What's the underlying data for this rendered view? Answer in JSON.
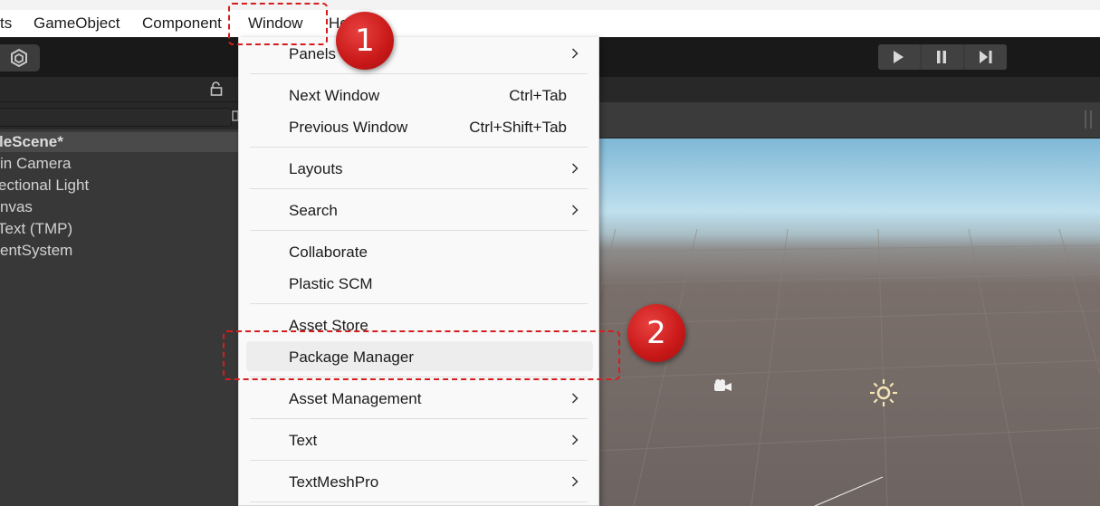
{
  "menubar": {
    "items": [
      "ts",
      "GameObject",
      "Component",
      "Window",
      "Help"
    ]
  },
  "hierarchy": {
    "scene_name": "leScene*",
    "items": [
      "in Camera",
      "ectional Light",
      "nvas",
      "Text (TMP)",
      "entSystem"
    ]
  },
  "toolbar": {
    "icons": [
      "unity-logo-icon",
      "play-icon",
      "pause-icon",
      "step-icon"
    ]
  },
  "window_menu": {
    "items": [
      {
        "label": "Panels",
        "shortcut": "",
        "submenu": true
      },
      {
        "label": "Next Window",
        "shortcut": "Ctrl+Tab",
        "submenu": false
      },
      {
        "label": "Previous Window",
        "shortcut": "Ctrl+Shift+Tab",
        "submenu": false
      },
      {
        "label": "Layouts",
        "shortcut": "",
        "submenu": true
      },
      {
        "label": "Search",
        "shortcut": "",
        "submenu": true
      },
      {
        "label": "Collaborate",
        "shortcut": "",
        "submenu": false
      },
      {
        "label": "Plastic SCM",
        "shortcut": "",
        "submenu": false
      },
      {
        "label": "Asset Store",
        "shortcut": "",
        "submenu": false
      },
      {
        "label": "Package Manager",
        "shortcut": "",
        "submenu": false
      },
      {
        "label": "Asset Management",
        "shortcut": "",
        "submenu": true
      },
      {
        "label": "Text",
        "shortcut": "",
        "submenu": true
      },
      {
        "label": "TextMeshPro",
        "shortcut": "",
        "submenu": true
      }
    ],
    "highlighted": "Package Manager"
  },
  "annotations": {
    "step1": "1",
    "step2": "2",
    "color": "#d51d1d"
  }
}
